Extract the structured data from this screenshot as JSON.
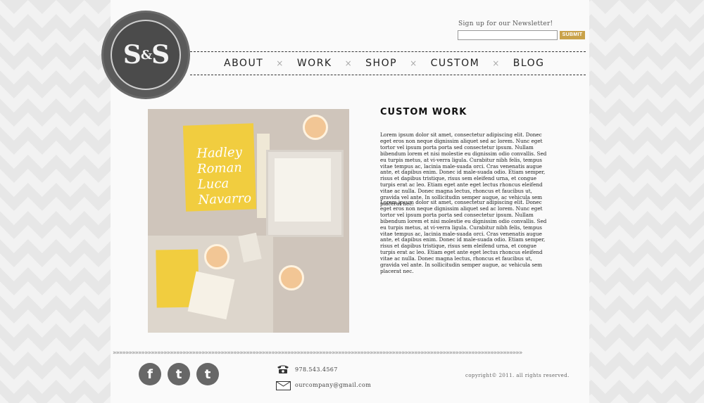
{
  "logo": {
    "left": "S",
    "amp": "&",
    "right": "S"
  },
  "newsletter": {
    "label": "Sign up for our Newsletter!",
    "placeholder": "",
    "button": "SUBMIT"
  },
  "nav": {
    "items": [
      "ABOUT",
      "WORK",
      "SHOP",
      "CUSTOM",
      "BLOG"
    ],
    "separator": "×"
  },
  "main": {
    "title": "CUSTOM WORK",
    "paragraphs": [
      "Lorem ipsum dolor sit amet, consectetur adipiscing elit. Donec eget eros non neque dignissim aliquet sed ac lorem. Nunc eget tortor vel ipsum porta porta sed consectetur ipsum. Nullam bibendum lorem et nisi molestie eu dignissim odio convallis. Sed eu turpis metus, at vi-verra ligula. Curabitur nibh felis, tempus vitae tempus ac, lacinia male-suada orci. Cras venenatis augue ante, et dapibus enim. Donec id male-suada odio. Etiam semper, risus et dapibus tristique, risus sem eleifend urna, et congue turpis erat ac leo. Etiam eget ante eget lectus rhoncus eleifend vitae ac nulla. Donec magna lectus, rhoncus et faucibus ut, gravida vel ante. In sollicitudin semper augue, ac vehicula sem placerat nec.",
      "Lorem ipsum dolor sit amet, consectetur adipiscing elit. Donec eget eros non neque dignissim aliquet sed ac lorem. Nunc eget tortor vel ipsum porta porta sed consectetur ipsum. Nullam bibendum lorem et nisi molestie eu dignissim odio convallis. Sed eu turpis metus, at vi-verra ligula. Curabitur nibh felis, tempus vitae tempus ac, lacinia male-suada orci. Cras venenatis augue ante, et dapibus enim. Donec id male-suada odio. Etiam semper, risus et dapibus tristique, risus sem eleifend urna, et congue turpis erat ac leo. Etiam eget ante eget lectus rhoncus eleifend vitae ac nulla. Donec magna lectus, rhoncus et faucibus ut, gravida vel ante. In sollicitudin semper augue, ac vehicula sem placerat nec."
    ],
    "image_text": "Hadley Roman Luca Navarro"
  },
  "footer": {
    "social": [
      {
        "icon": "facebook-icon",
        "glyph": "f"
      },
      {
        "icon": "twitter-icon",
        "glyph": "t"
      },
      {
        "icon": "tumblr-icon",
        "glyph": "t"
      }
    ],
    "phone": "978.543.4567",
    "email": "ourcompany@gmail.com",
    "copyright": "copyright© 2011. all rights reserved."
  },
  "colors": {
    "accent": "#c9a24a",
    "yellow": "#f1cd3f",
    "dark": "#4b4b4b"
  }
}
